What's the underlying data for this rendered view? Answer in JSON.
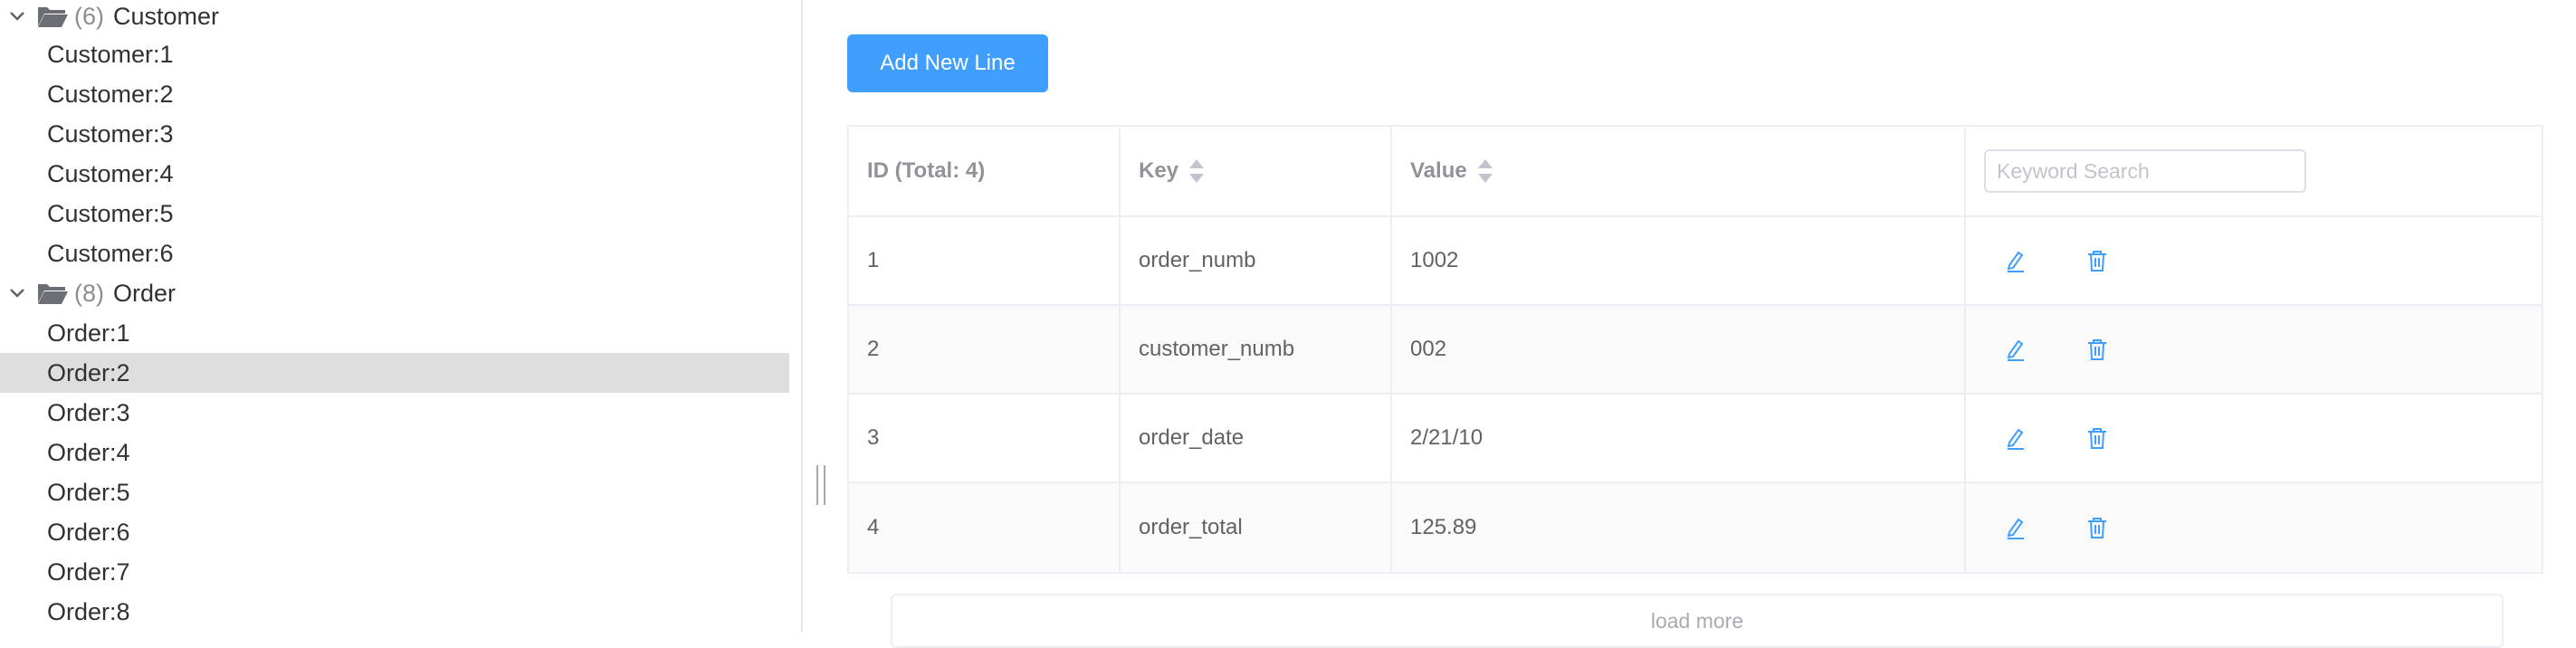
{
  "tree": {
    "groups": [
      {
        "count": "(6)",
        "name": "Customer",
        "items": [
          "Customer:1",
          "Customer:2",
          "Customer:3",
          "Customer:4",
          "Customer:5",
          "Customer:6"
        ]
      },
      {
        "count": "(8)",
        "name": "Order",
        "items": [
          "Order:1",
          "Order:2",
          "Order:3",
          "Order:4",
          "Order:5",
          "Order:6",
          "Order:7",
          "Order:8"
        ]
      }
    ],
    "selected": "Order:2"
  },
  "toolbar": {
    "add_label": "Add New Line"
  },
  "table": {
    "headers": {
      "id": "ID (Total: 4)",
      "key": "Key",
      "value": "Value"
    },
    "search_placeholder": "Keyword Search",
    "rows": [
      {
        "id": "1",
        "key": "order_numb",
        "value": "1002"
      },
      {
        "id": "2",
        "key": "customer_numb",
        "value": "002"
      },
      {
        "id": "3",
        "key": "order_date",
        "value": "2/21/10"
      },
      {
        "id": "4",
        "key": "order_total",
        "value": "125.89"
      }
    ],
    "row_actions": [
      "edit-icon",
      "delete-icon"
    ]
  },
  "load_more_label": "load more",
  "colors": {
    "accent": "#409eff",
    "selected_row": "#dedede",
    "border": "#ebeef5"
  }
}
